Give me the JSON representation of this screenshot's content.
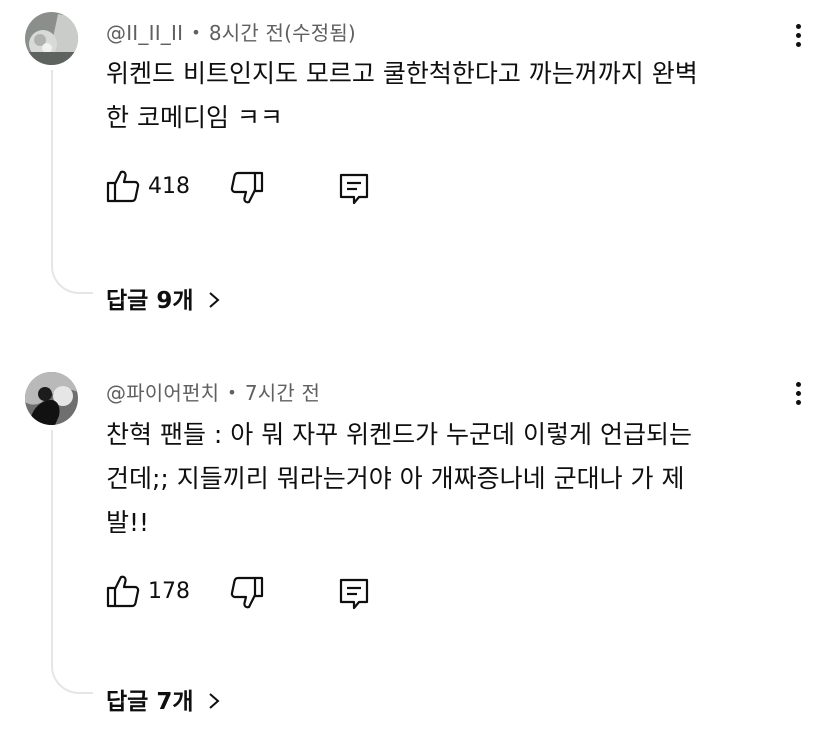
{
  "comments": [
    {
      "author": "@II_II_II",
      "separator": "•",
      "time": "8시간 전(수정됨)",
      "text": "위켄드 비트인지도 모르고 쿨한척한다고 까는꺼까지 완벽\n한 코메디임 ㅋㅋ",
      "likes": "418",
      "replies_label": "답글 9개",
      "avatar_icon": "profile-photo-icon"
    },
    {
      "author": "@파이어펀치",
      "separator": "•",
      "time": "7시간 전",
      "text": "찬혁 팬들 : 아 뭐 자꾸 위켄드가 누군데 이렇게 언급되는\n건데;; 지들끼리 뭐라는거야 아 개짜증나네 군대나 가 제\n발!!",
      "likes": "178",
      "replies_label": "답글 7개",
      "avatar_icon": "profile-photo-icon"
    }
  ],
  "icons": {
    "like": "thumbs-up-icon",
    "dislike": "thumbs-down-icon",
    "reply": "reply-comment-icon",
    "more": "more-vert-icon",
    "chevron": "chevron-right-icon"
  },
  "colors": {
    "text": "#0f0f0f",
    "secondary": "#606060",
    "thread_line": "#e5e5e5"
  }
}
